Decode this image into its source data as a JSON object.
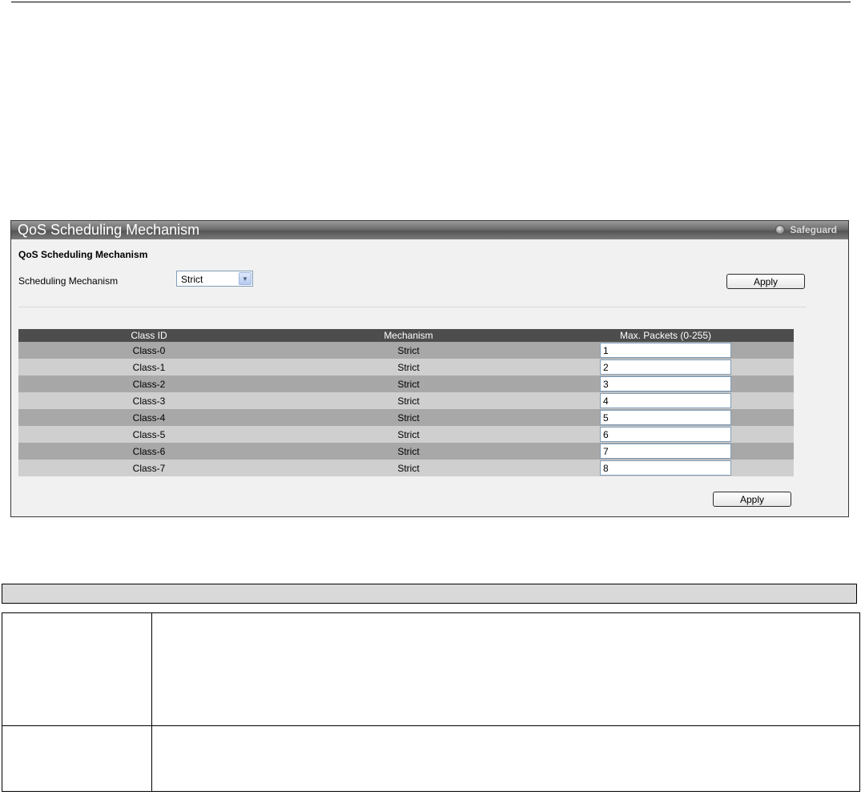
{
  "panel": {
    "title": "QoS Scheduling Mechanism",
    "safeguard_label": "Safeguard"
  },
  "form": {
    "section_title": "QoS Scheduling Mechanism",
    "scheduling_label": "Scheduling Mechanism",
    "scheduling_value": "Strict",
    "apply_label": "Apply"
  },
  "table": {
    "headers": [
      "Class ID",
      "Mechanism",
      "Max. Packets (0-255)"
    ],
    "rows": [
      {
        "class_id": "Class-0",
        "mechanism": "Strict",
        "max_packets": "1"
      },
      {
        "class_id": "Class-1",
        "mechanism": "Strict",
        "max_packets": "2"
      },
      {
        "class_id": "Class-2",
        "mechanism": "Strict",
        "max_packets": "3"
      },
      {
        "class_id": "Class-3",
        "mechanism": "Strict",
        "max_packets": "4"
      },
      {
        "class_id": "Class-4",
        "mechanism": "Strict",
        "max_packets": "5"
      },
      {
        "class_id": "Class-5",
        "mechanism": "Strict",
        "max_packets": "6"
      },
      {
        "class_id": "Class-6",
        "mechanism": "Strict",
        "max_packets": "7"
      },
      {
        "class_id": "Class-7",
        "mechanism": "Strict",
        "max_packets": "8"
      }
    ],
    "apply_label": "Apply"
  },
  "icons": {
    "safeguard": "radio-indicator-icon",
    "dropdown": "chevron-down-icon"
  },
  "colors": {
    "header_dark": "#4d4d4d",
    "row_dark": "#a8a8a8",
    "row_light": "#cfcfcf",
    "panel_bg": "#f1f1f1"
  }
}
